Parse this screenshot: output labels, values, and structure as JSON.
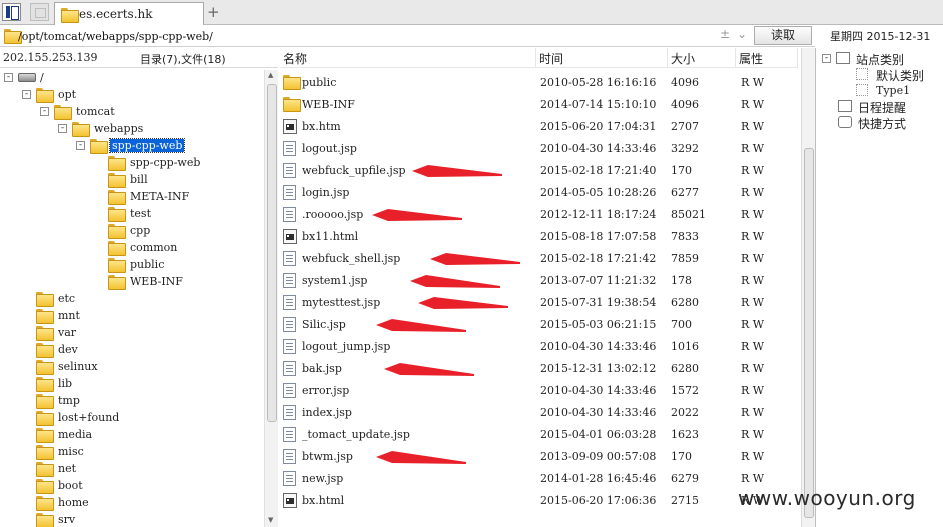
{
  "tabs": [
    {
      "label": "es.ecerts.hk"
    }
  ],
  "address": {
    "path": "/opt/tomcat/webapps/spp-cpp-web/",
    "read_label": "读取",
    "clear_glyph": "±",
    "dropdown_glyph": "⌄"
  },
  "datetime": {
    "weekday": "星期四",
    "date": "2015-12-31"
  },
  "info": {
    "ip": "202.155.253.139",
    "counts": "目录(7),文件(18)"
  },
  "columns": {
    "name": "名称",
    "time": "时间",
    "size": "大小",
    "attr": "属性"
  },
  "tree": [
    {
      "label": "/",
      "type": "drive",
      "expander": "-"
    },
    {
      "label": "opt",
      "expander": "-"
    },
    {
      "label": "tomcat",
      "expander": "-"
    },
    {
      "label": "webapps",
      "expander": "-"
    },
    {
      "label": "spp-cpp-web",
      "expander": "-",
      "selected": true
    },
    {
      "label": "spp-cpp-web"
    },
    {
      "label": "bill"
    },
    {
      "label": "META-INF"
    },
    {
      "label": "test"
    },
    {
      "label": "cpp"
    },
    {
      "label": "common"
    },
    {
      "label": "public"
    },
    {
      "label": "WEB-INF"
    },
    {
      "label": "etc"
    },
    {
      "label": "mnt"
    },
    {
      "label": "var"
    },
    {
      "label": "dev"
    },
    {
      "label": "selinux"
    },
    {
      "label": "lib"
    },
    {
      "label": "tmp"
    },
    {
      "label": "lost+found"
    },
    {
      "label": "media"
    },
    {
      "label": "misc"
    },
    {
      "label": "net"
    },
    {
      "label": "boot"
    },
    {
      "label": "home"
    },
    {
      "label": "srv"
    }
  ],
  "files": [
    {
      "name": "public",
      "time": "2010-05-28 16:16:16",
      "size": "4096",
      "attr": "R W",
      "icon": "folder"
    },
    {
      "name": "WEB-INF",
      "time": "2014-07-14 15:10:10",
      "size": "4096",
      "attr": "R W",
      "icon": "folder"
    },
    {
      "name": "bx.htm",
      "time": "2015-06-20 17:04:31",
      "size": "2707",
      "attr": "R W",
      "icon": "html"
    },
    {
      "name": "logout.jsp",
      "time": "2010-04-30 14:33:46",
      "size": "3292",
      "attr": "R W",
      "icon": "file"
    },
    {
      "name": "webfuck_upfile.jsp",
      "time": "2015-02-18 17:21:40",
      "size": "170",
      "attr": "R W",
      "icon": "file",
      "marked": true
    },
    {
      "name": "login.jsp",
      "time": "2014-05-05 10:28:26",
      "size": "6277",
      "attr": "R W",
      "icon": "file"
    },
    {
      "name": ".rooooo.jsp",
      "time": "2012-12-11 18:17:24",
      "size": "85021",
      "attr": "R W",
      "icon": "file",
      "marked": true
    },
    {
      "name": "bx11.html",
      "time": "2015-08-18 17:07:58",
      "size": "7833",
      "attr": "R W",
      "icon": "html"
    },
    {
      "name": "webfuck_shell.jsp",
      "time": "2015-02-18 17:21:42",
      "size": "7859",
      "attr": "R W",
      "icon": "file",
      "marked": true
    },
    {
      "name": "system1.jsp",
      "time": "2013-07-07 11:21:32",
      "size": "178",
      "attr": "R W",
      "icon": "file",
      "marked": true
    },
    {
      "name": "mytesttest.jsp",
      "time": "2015-07-31 19:38:54",
      "size": "6280",
      "attr": "R W",
      "icon": "file",
      "marked": true
    },
    {
      "name": "Silic.jsp",
      "time": "2015-05-03 06:21:15",
      "size": "700",
      "attr": "R W",
      "icon": "file",
      "marked": true
    },
    {
      "name": "logout_jump.jsp",
      "time": "2010-04-30 14:33:46",
      "size": "1016",
      "attr": "R W",
      "icon": "file"
    },
    {
      "name": "bak.jsp",
      "time": "2015-12-31 13:02:12",
      "size": "6280",
      "attr": "R W",
      "icon": "file",
      "marked": true
    },
    {
      "name": "error.jsp",
      "time": "2010-04-30 14:33:46",
      "size": "1572",
      "attr": "R W",
      "icon": "file"
    },
    {
      "name": "index.jsp",
      "time": "2010-04-30 14:33:46",
      "size": "2022",
      "attr": "R W",
      "icon": "file"
    },
    {
      "name": "_tomact_update.jsp",
      "time": "2015-04-01 06:03:28",
      "size": "1623",
      "attr": "R W",
      "icon": "file"
    },
    {
      "name": "btwm.jsp",
      "time": "2013-09-09 00:57:08",
      "size": "170",
      "attr": "R W",
      "icon": "file",
      "marked": true
    },
    {
      "name": "new.jsp",
      "time": "2014-01-28 16:45:46",
      "size": "6279",
      "attr": "R W",
      "icon": "file"
    },
    {
      "name": "bx.html",
      "time": "2015-06-20 17:06:36",
      "size": "2715",
      "attr": "R W",
      "icon": "html"
    }
  ],
  "right_panel": {
    "site_category": "站点类别",
    "default_category": "默认类别",
    "type1": "Type1",
    "schedule": "日程提醒",
    "shortcut": "快捷方式"
  },
  "annotation_color": "#e8202a",
  "watermark": "www.wooyun.org"
}
